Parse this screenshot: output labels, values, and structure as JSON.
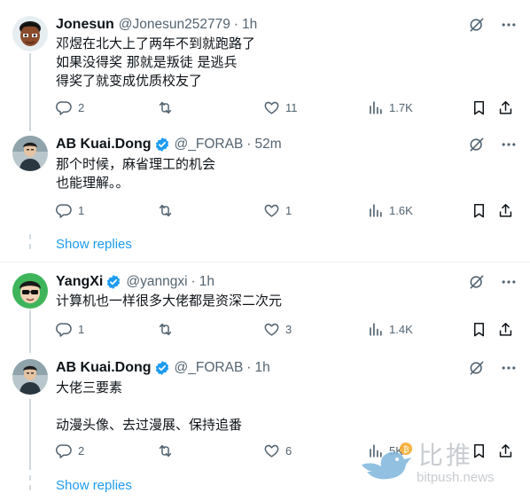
{
  "tweets": [
    {
      "name": "Jonesun",
      "handle": "@Jonesun252779",
      "separator": "·",
      "time": "1h",
      "lines": [
        "邓煜在北大上了两年不到就跑路了",
        "如果没得奖 那就是叛徒 是逃兵",
        "得奖了就变成优质校友了"
      ],
      "replies": "2",
      "retweets": "",
      "likes": "11",
      "views": "1.7K"
    },
    {
      "name": "AB Kuai.Dong",
      "handle": "@_FORAB",
      "separator": "·",
      "time": "52m",
      "lines": [
        "那个时候，麻省理工的机会",
        "也能理解。。"
      ],
      "replies": "1",
      "retweets": "",
      "likes": "1",
      "views": "1.6K",
      "show_replies": "Show replies"
    },
    {
      "name": "YangXi",
      "handle": "@yanngxi",
      "separator": "·",
      "time": "1h",
      "lines": [
        "计算机也一样很多大佬都是资深二次元"
      ],
      "replies": "1",
      "retweets": "",
      "likes": "3",
      "views": "1.4K"
    },
    {
      "name": "AB Kuai.Dong",
      "handle": "@_FORAB",
      "separator": "·",
      "time": "1h",
      "lines": [
        "大佬三要素",
        "",
        "动漫头像、去过漫展、保持追番"
      ],
      "replies": "2",
      "retweets": "",
      "likes": "6",
      "views": "5K",
      "show_replies": "Show replies"
    }
  ],
  "watermark": {
    "cn": "比推",
    "en": "bitpush.news"
  },
  "colors": {
    "accent": "#1d9bf0",
    "muted": "#536471",
    "line": "#cfd9de"
  },
  "icons": [
    "grok-icon",
    "more-icon",
    "reply-icon",
    "retweet-icon",
    "like-icon",
    "views-icon",
    "bookmark-icon",
    "share-icon",
    "verified-badge-icon"
  ]
}
